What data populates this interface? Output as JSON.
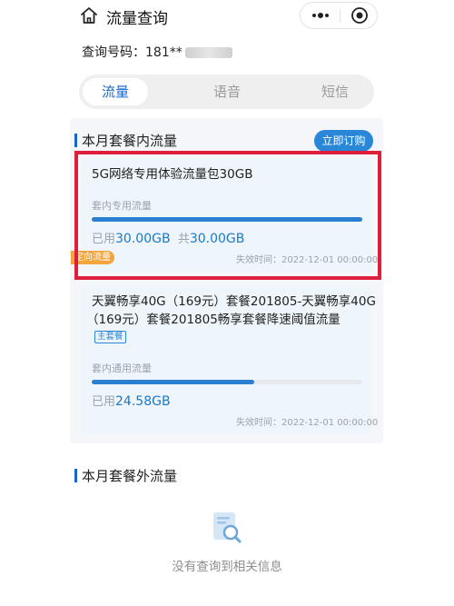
{
  "header": {
    "title": "流量查询"
  },
  "query": {
    "label": "查询号码：",
    "number": "181**"
  },
  "tabs": [
    {
      "label": "流量"
    },
    {
      "label": "语音"
    },
    {
      "label": "短信"
    }
  ],
  "in_plan": {
    "section_title": "本月套餐内流量",
    "subscribe_label": "立即订购",
    "cards": [
      {
        "name": "5G网络专用体验流量包30GB",
        "usage_type": "套内专用流量",
        "progress_fraction": 1.0,
        "used_prefix": "已用",
        "used_value": "30.00GB",
        "total_prefix": "共",
        "total_value": "30.00GB",
        "tag": "定向流量",
        "expire": "失效时间：2022-12-01 00:00:00"
      },
      {
        "name_line1": "天翼畅享40G（169元）套餐201805-天翼畅享40G",
        "name_line2": "（169元）套餐201805畅享套餐降速阈值流量",
        "tag": "主套餐",
        "usage_type": "套内通用流量",
        "progress_fraction": 0.6,
        "used_prefix": "已用",
        "used_value": "24.58GB",
        "expire": "失效时间：2022-12-01 00:00:00"
      }
    ]
  },
  "out_plan": {
    "section_title": "本月套餐外流量",
    "empty_text": "没有查询到相关信息"
  },
  "colors": {
    "accent": "#2a87d8",
    "highlight": "#dd1f3b",
    "tag_orange": "#f3a43a"
  }
}
